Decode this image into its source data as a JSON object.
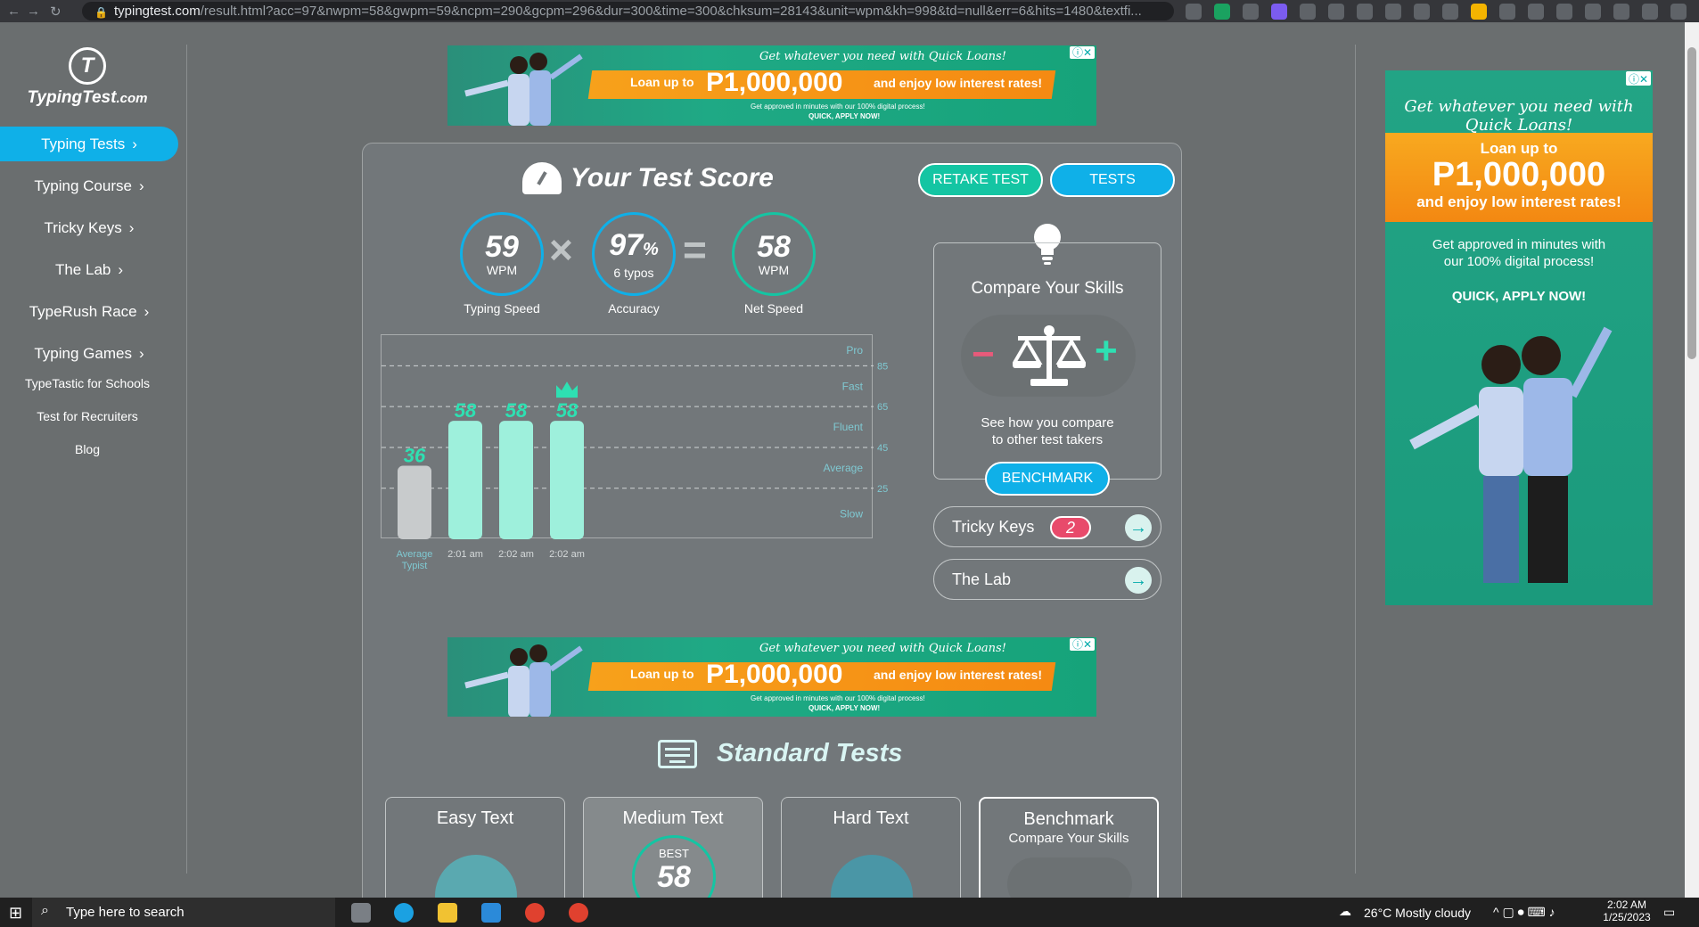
{
  "browser": {
    "url_main": "typingtest.com",
    "url_rest": "/result.html?acc=97&nwpm=58&gwpm=59&ncpm=290&gcpm=296&dur=300&time=300&chksum=28143&unit=wpm&kh=998&td=null&err=6&hits=1480&textfi..."
  },
  "sidebar": {
    "logo_mark": "T",
    "logo_name": "TypingTest",
    "logo_suffix": ".com",
    "items": [
      {
        "label": "Typing Tests"
      },
      {
        "label": "Typing Course"
      },
      {
        "label": "Tricky Keys"
      },
      {
        "label": "The Lab"
      },
      {
        "label": "TypeRush Race"
      },
      {
        "label": "Typing Games"
      }
    ],
    "links": [
      {
        "label": "TypeTastic for Schools"
      },
      {
        "label": "Test for Recruiters"
      },
      {
        "label": "Blog"
      }
    ]
  },
  "ad": {
    "tagline": "Get whatever you need with Quick Loans!",
    "loan_prefix": "Loan up to",
    "amount": "P1,000,000",
    "loan_suffix": "and enjoy low interest rates!",
    "sub": "Get approved in minutes with our 100% digital process!",
    "cta": "QUICK, APPLY NOW!",
    "close": "ⓘ✕"
  },
  "right_ad": {
    "tagline": "Get whatever you need with Quick Loans!",
    "loan_prefix": "Loan up to",
    "amount": "P1,000,000",
    "loan_suffix": "and enjoy low interest rates!",
    "sub": "Get approved in minutes with our 100% digital process!",
    "cta": "QUICK, APPLY NOW!"
  },
  "score": {
    "title": "Your Test Score",
    "retake_label": "RETAKE TEST",
    "tests_label": "TESTS",
    "typing_speed": {
      "value": "59",
      "unit": "WPM",
      "label": "Typing Speed"
    },
    "accuracy": {
      "value": "97",
      "pct": "%",
      "sub": "6  typos",
      "label": "Accuracy"
    },
    "net_speed": {
      "value": "58",
      "unit": "WPM",
      "label": "Net Speed"
    },
    "times_op": "×",
    "equals_op": "="
  },
  "chart_data": {
    "type": "bar",
    "categories": [
      "Average Typist",
      "2:01 am",
      "2:02 am",
      "2:02 am"
    ],
    "values": [
      36,
      58,
      58,
      58
    ],
    "value_labels": [
      "36",
      "58",
      "58",
      "58"
    ],
    "ylim": [
      0,
      100
    ],
    "gridlines": [
      25,
      45,
      65,
      85
    ],
    "levels": [
      "Slow",
      "Average",
      "Fluent",
      "Fast",
      "Pro"
    ],
    "best_index": 3,
    "colors": {
      "average": "#c8cbcc",
      "result": "#9ef0dc",
      "result_dark": "#8aeacf",
      "label": "#2ee0b2",
      "grid": "#d0d4d5",
      "level_text": "#7fc9d2"
    }
  },
  "compare": {
    "title": "Compare Your Skills",
    "desc_line1": "See how you compare",
    "desc_line2": "to other test takers",
    "button": "BENCHMARK",
    "minus": "−",
    "plus": "+"
  },
  "pills": [
    {
      "label": "Tricky Keys",
      "badge": "2"
    },
    {
      "label": "The Lab"
    }
  ],
  "standard": {
    "title": "Standard Tests",
    "cards": [
      {
        "title": "Easy Text"
      },
      {
        "title": "Medium Text",
        "best_label": "BEST",
        "best_value": "58"
      },
      {
        "title": "Hard Text"
      },
      {
        "title": "Benchmark",
        "sub": "Compare Your Skills"
      }
    ]
  },
  "taskbar": {
    "search_placeholder": "Type here to search",
    "weather": "26°C  Mostly cloudy",
    "time": "2:02 AM",
    "date": "1/25/2023"
  },
  "colors": {
    "accent": "#0fb0e8",
    "teal": "#14c5a3",
    "panel": "#72777a",
    "page": "#6a6e6f"
  }
}
